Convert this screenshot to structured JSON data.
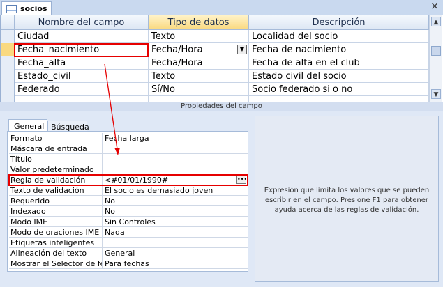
{
  "window": {
    "tab_title": "socios",
    "close_glyph": "×"
  },
  "grid": {
    "headers": [
      "Nombre del campo",
      "Tipo de datos",
      "Descripción"
    ],
    "rows": [
      {
        "name": "Ciudad",
        "type": "Texto",
        "desc": "Localidad del socio"
      },
      {
        "name": "Fecha_nacimiento",
        "type": "Fecha/Hora",
        "desc": "Fecha de nacimiento"
      },
      {
        "name": "Fecha_alta",
        "type": "Fecha/Hora",
        "desc": "Fecha de alta en el club"
      },
      {
        "name": "Estado_civil",
        "type": "Texto",
        "desc": "Estado civil del socio"
      },
      {
        "name": "Federado",
        "type": "Sí/No",
        "desc": "Socio federado si o no"
      },
      {
        "name": "",
        "type": "",
        "desc": ""
      }
    ]
  },
  "properties_bar": "Propiedades del campo",
  "tabs": {
    "general": "General",
    "lookup": "Búsqueda"
  },
  "props": [
    {
      "label": "Formato",
      "value": "Fecha larga"
    },
    {
      "label": "Máscara de entrada",
      "value": ""
    },
    {
      "label": "Título",
      "value": ""
    },
    {
      "label": "Valor predeterminado",
      "value": ""
    },
    {
      "label": "Regla de validación",
      "value": "<#01/01/1990#"
    },
    {
      "label": "Texto de validación",
      "value": "El socio es demasiado joven"
    },
    {
      "label": "Requerido",
      "value": "No"
    },
    {
      "label": "Indexado",
      "value": "No"
    },
    {
      "label": "Modo IME",
      "value": "Sin Controles"
    },
    {
      "label": "Modo de oraciones IME",
      "value": "Nada"
    },
    {
      "label": "Etiquetas inteligentes",
      "value": ""
    },
    {
      "label": "Alineación del texto",
      "value": "General"
    },
    {
      "label": "Mostrar el Selector de fecha",
      "value": "Para fechas"
    }
  ],
  "help_text": "Expresión que limita los valores que se pueden escribir en el campo. Presione F1 para obtener ayuda acerca de las reglas de validación.",
  "colors": {
    "highlight": "#e60000",
    "selected_header": "#f9d980"
  }
}
